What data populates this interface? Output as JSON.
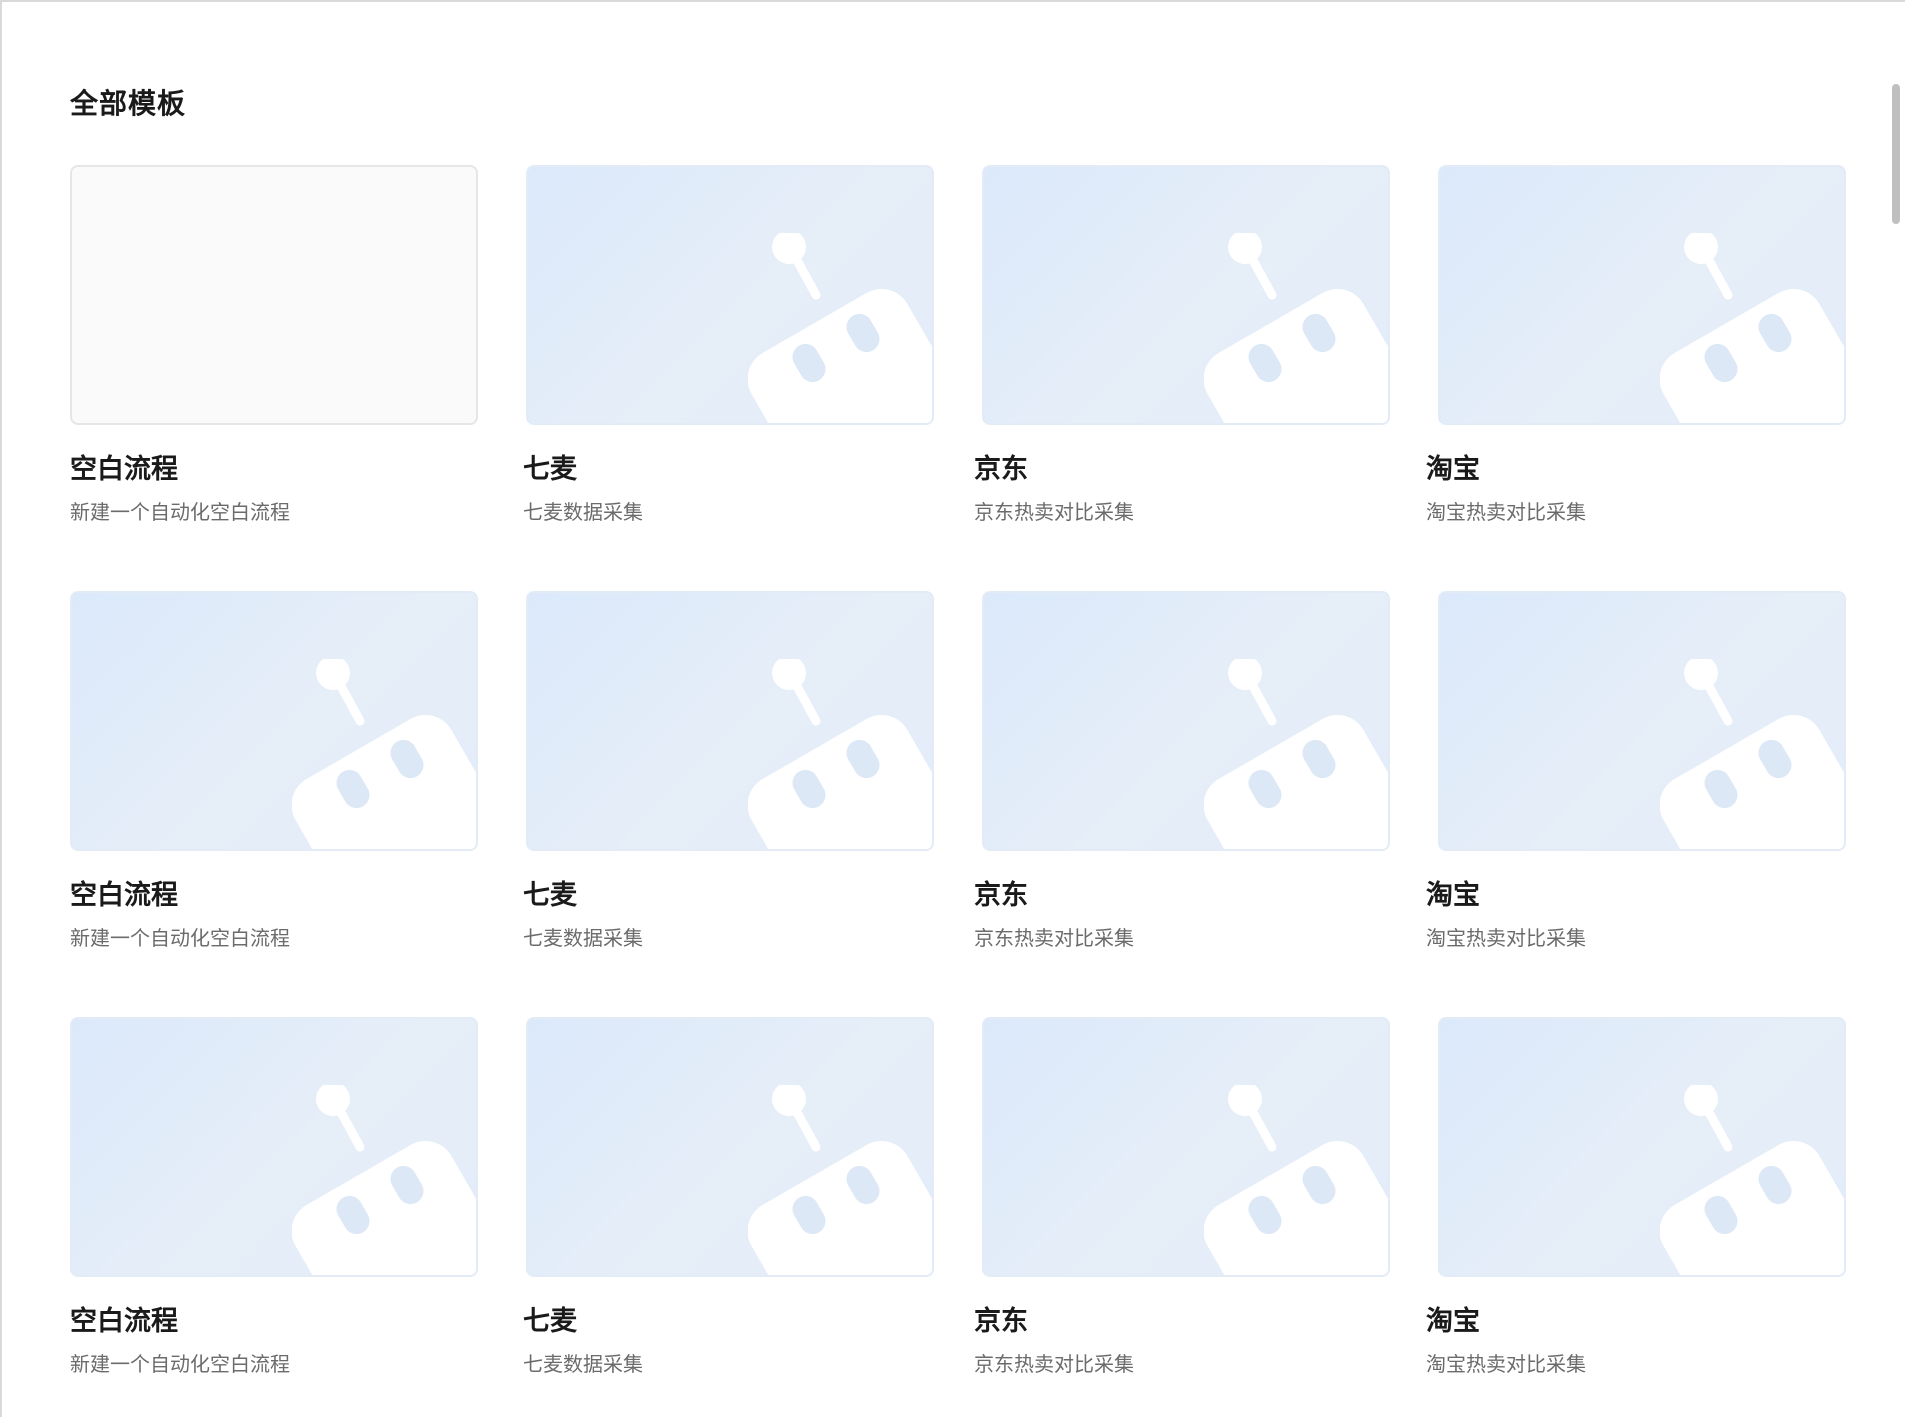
{
  "section": {
    "title": "全部模板"
  },
  "templates": [
    {
      "title": "空白流程",
      "desc": "新建一个自动化空白流程",
      "blank": true
    },
    {
      "title": "七麦",
      "desc": "七麦数据采集",
      "blank": false
    },
    {
      "title": "京东",
      "desc": "京东热卖对比采集",
      "blank": false
    },
    {
      "title": "淘宝",
      "desc": "淘宝热卖对比采集",
      "blank": false
    },
    {
      "title": "空白流程",
      "desc": "新建一个自动化空白流程",
      "blank": false
    },
    {
      "title": "七麦",
      "desc": "七麦数据采集",
      "blank": false
    },
    {
      "title": "京东",
      "desc": "京东热卖对比采集",
      "blank": false
    },
    {
      "title": "淘宝",
      "desc": "淘宝热卖对比采集",
      "blank": false
    },
    {
      "title": "空白流程",
      "desc": "新建一个自动化空白流程",
      "blank": false
    },
    {
      "title": "七麦",
      "desc": "七麦数据采集",
      "blank": false
    },
    {
      "title": "京东",
      "desc": "京东热卖对比采集",
      "blank": false
    },
    {
      "title": "淘宝",
      "desc": "淘宝热卖对比采集",
      "blank": false
    }
  ],
  "icons": {
    "thumbnail": "robot-icon"
  },
  "colors": {
    "thumbnail_bg_start": "#dbe9fb",
    "thumbnail_bg_end": "#e2ecf9",
    "robot": "#ffffff",
    "robot_eye": "#dde8f7",
    "title_text": "#1a1a1a",
    "desc_text": "#6b6b6b"
  }
}
